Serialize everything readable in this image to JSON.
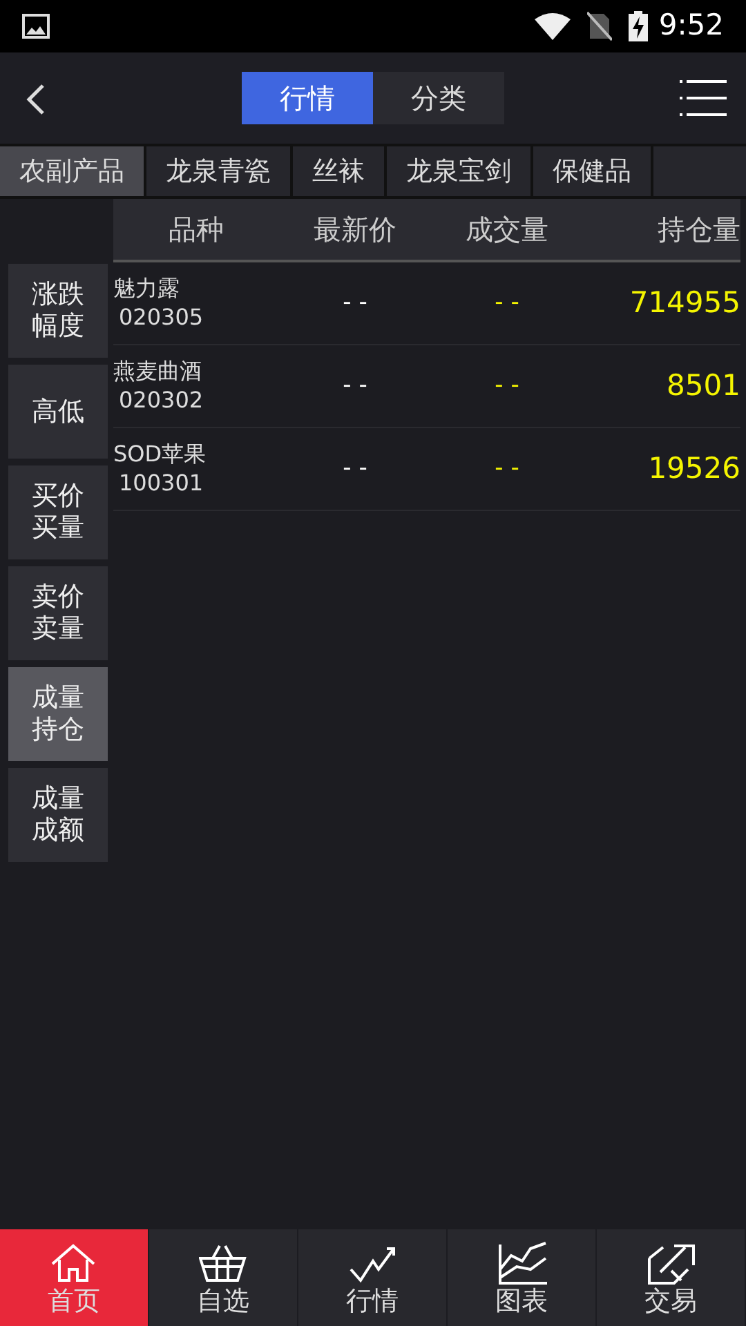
{
  "status_bar": {
    "time": "9:52"
  },
  "header": {
    "tabs": [
      {
        "label": "行情",
        "selected": true
      },
      {
        "label": "分类",
        "selected": false
      }
    ]
  },
  "categories": [
    {
      "label": "农副产品",
      "selected": true
    },
    {
      "label": "龙泉青瓷",
      "selected": false
    },
    {
      "label": "丝袜",
      "selected": false
    },
    {
      "label": "龙泉宝剑",
      "selected": false
    },
    {
      "label": "保健品",
      "selected": false
    }
  ],
  "side_buttons": [
    {
      "label": "涨跌幅度",
      "selected": false
    },
    {
      "label": "高低",
      "selected": false
    },
    {
      "label": "买价买量",
      "selected": false
    },
    {
      "label": "卖价卖量",
      "selected": false
    },
    {
      "label": "成量持仓",
      "selected": true
    },
    {
      "label": "成量成额",
      "selected": false
    }
  ],
  "table": {
    "columns": [
      "品种",
      "最新价",
      "成交量",
      "持仓量"
    ],
    "rows": [
      {
        "name": "魅力露",
        "code": "020305",
        "price": "- -",
        "volume": "- -",
        "open_interest": "714955"
      },
      {
        "name": "燕麦曲酒",
        "code": "020302",
        "price": "- -",
        "volume": "- -",
        "open_interest": "8501"
      },
      {
        "name": "SOD苹果",
        "code": "100301",
        "price": "- -",
        "volume": "- -",
        "open_interest": "19526"
      }
    ]
  },
  "bottom_nav": [
    {
      "label": "首页",
      "selected": true
    },
    {
      "label": "自选",
      "selected": false
    },
    {
      "label": "行情",
      "selected": false
    },
    {
      "label": "图表",
      "selected": false
    },
    {
      "label": "交易",
      "selected": false
    }
  ]
}
